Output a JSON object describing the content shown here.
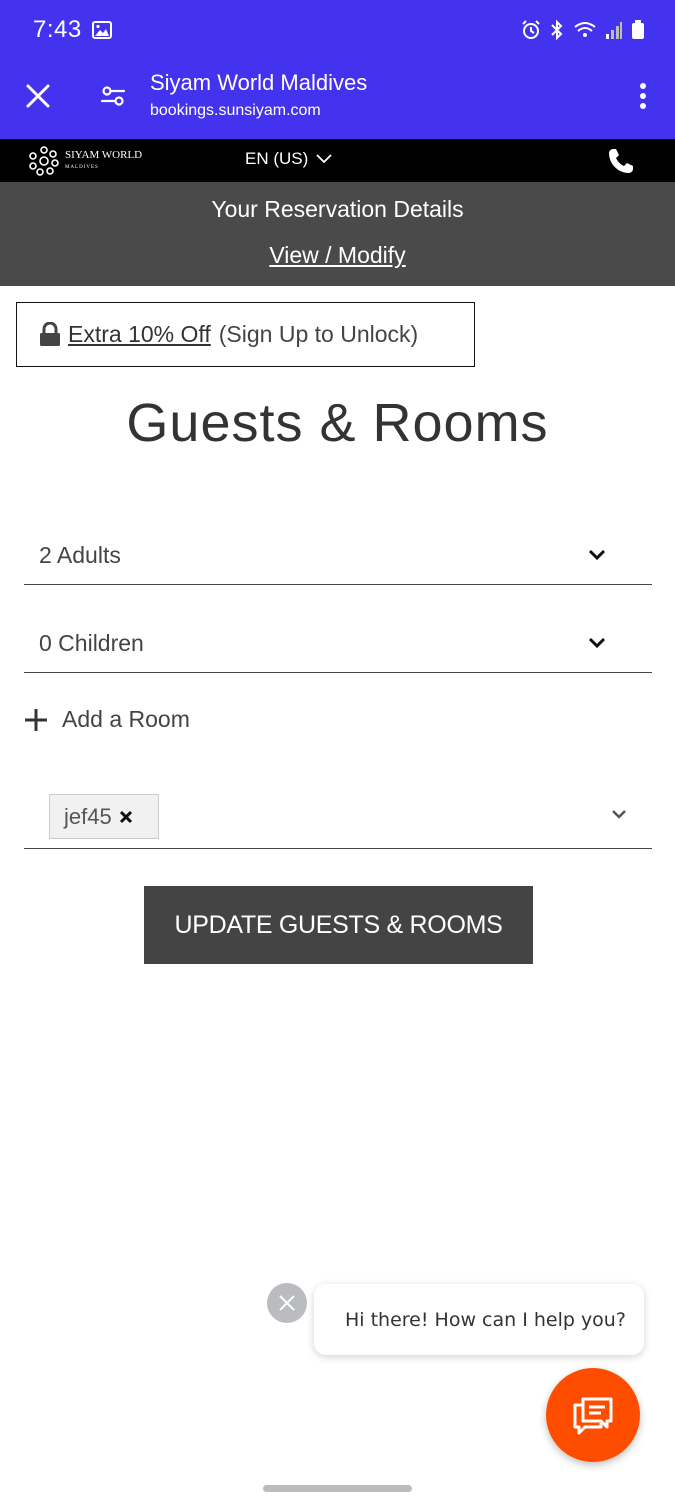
{
  "status_bar": {
    "time": "7:43"
  },
  "toolbar": {
    "title": "Siyam World Maldives",
    "url": "bookings.sunsiyam.com"
  },
  "site_header": {
    "brand": "SIYAM WORLD",
    "brand_sub": "MALDIVES",
    "language": "EN (US)"
  },
  "reservation": {
    "title": "Your Reservation Details",
    "link": "View / Modify"
  },
  "offer": {
    "link": "Extra 10% Off",
    "note": "(Sign Up to Unlock)"
  },
  "heading": "Guests & Rooms",
  "guests": {
    "adults": "2 Adults",
    "children": "0 Children"
  },
  "add_room_label": "Add a Room",
  "promo": {
    "tag": "jef45"
  },
  "update_button": "UPDATE GUESTS & ROOMS",
  "chat": {
    "message": "Hi there! How can I help you?"
  },
  "colors": {
    "browser_bar": "#4433ee",
    "reservation_bar": "#4a4a4a",
    "button": "#444444",
    "chat_fab": "#ff4d00"
  }
}
